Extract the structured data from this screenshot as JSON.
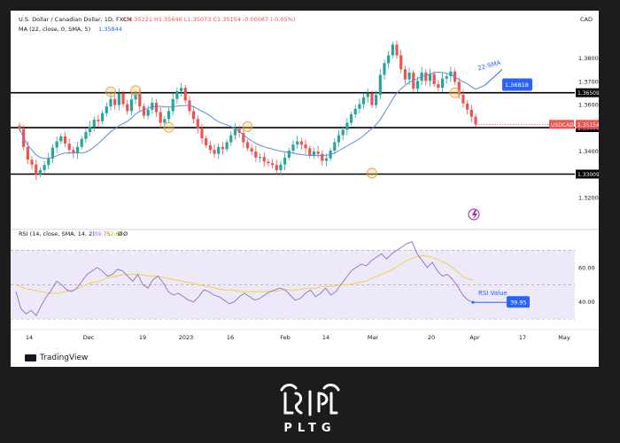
{
  "header": {
    "title": "U.S. Dollar / Canadian Dollar, 1D, FXCM",
    "ohlc": "O1.35221 H1.35646 L1.35073 C1.35154 -0.00067 (-0.05%)",
    "ma_info": "MA (22, close, 0, SMA, 5)",
    "ma_value": "1.35844",
    "currency": "CAD"
  },
  "footer": {
    "tradingview": "TradingView",
    "brand": "PLTG"
  },
  "colors": {
    "up": "#26a69a",
    "down": "#ef5350",
    "ma": "#5b8bd9",
    "rsi": "#8e6fd0",
    "rsi_sma": "#f5d13a",
    "accent_blue": "#2962ff",
    "rsi_band": "#ede9f9"
  },
  "chart_data": [
    {
      "type": "candlestick",
      "title": "U.S. Dollar / Canadian Dollar, 1D, FXCM",
      "ylim": [
        1.312,
        1.3905
      ],
      "yticks": [
        "1.38000",
        "1.37000",
        "1.36000",
        "1.35000",
        "1.34000",
        "1.33000",
        "1.32000"
      ],
      "xticks": [
        "14",
        "Dec",
        "19",
        "2023",
        "16",
        "Feb",
        "14",
        "Mar",
        "20",
        "Apr",
        "17",
        "May"
      ],
      "series": [
        {
          "name": "USDCAD",
          "close_path": [
            1.3495,
            1.3418,
            1.3363,
            1.3342,
            1.33,
            1.3318,
            1.334,
            1.3368,
            1.3415,
            1.3442,
            1.3463,
            1.3432,
            1.3405,
            1.339,
            1.3418,
            1.3452,
            1.3482,
            1.3505,
            1.3535,
            1.3528,
            1.3563,
            1.3592,
            1.3624,
            1.3598,
            1.3648,
            1.3602,
            1.3572,
            1.3622,
            1.3646,
            1.3592,
            1.3552,
            1.3578,
            1.3608,
            1.3568,
            1.3522,
            1.3538,
            1.3572,
            1.3624,
            1.3658,
            1.3672,
            1.3618,
            1.3572,
            1.3538,
            1.3496,
            1.3455,
            1.3425,
            1.3405,
            1.3388,
            1.3418,
            1.3408,
            1.3438,
            1.3468,
            1.3495,
            1.3478,
            1.3438,
            1.3412,
            1.3398,
            1.3372,
            1.3375,
            1.3355,
            1.3348,
            1.334,
            1.3318,
            1.3342,
            1.3372,
            1.3402,
            1.3428,
            1.3442,
            1.3428,
            1.3412,
            1.3382,
            1.3398,
            1.3388,
            1.3358,
            1.3368,
            1.3402,
            1.3438,
            1.3468,
            1.3492,
            1.3522,
            1.3558,
            1.3582,
            1.3602,
            1.3632,
            1.3648,
            1.3598,
            1.3642,
            1.3728,
            1.3778,
            1.3812,
            1.3858,
            1.3812,
            1.3752,
            1.3708,
            1.3738,
            1.3668,
            1.3702,
            1.3738,
            1.3702,
            1.3732,
            1.3688,
            1.3672,
            1.3712,
            1.3722,
            1.3742,
            1.3698,
            1.3642,
            1.3605,
            1.3578,
            1.3548,
            1.3515
          ]
        },
        {
          "name": "MA (22, close, 0, SMA, 5)",
          "label": "22-SMA",
          "last": 1.3682
        }
      ],
      "horizontal_levels": [
        {
          "value": 1.3651,
          "label": "1.36509"
        },
        {
          "value": 1.3501,
          "label": "1.35006"
        },
        {
          "value": 1.3301,
          "label": "1.33009"
        }
      ],
      "price_labels": [
        {
          "value": 1.3682,
          "label": "1.36818"
        },
        {
          "value": 1.3515,
          "tag": "USDCAD",
          "label": "1.35154"
        }
      ],
      "annotations": [
        "22-SMA"
      ]
    },
    {
      "type": "line",
      "title": "RSI (14, close, SMA, 14, 2)",
      "header_values": [
        "39.75",
        "52.66",
        "Ø",
        "Ø"
      ],
      "ylim": [
        28,
        77
      ],
      "yticks": [
        "60.00",
        "40.00"
      ],
      "band": [
        30,
        70
      ],
      "midline": 50,
      "series": [
        {
          "name": "RSI",
          "values": [
            46,
            36,
            33,
            35,
            32,
            38,
            43,
            47,
            52,
            50,
            47,
            46,
            48,
            52,
            56,
            58,
            60,
            58,
            55,
            56,
            59,
            58,
            55,
            52,
            56,
            50,
            48,
            53,
            55,
            51,
            46,
            44,
            45,
            43,
            41,
            40,
            43,
            47,
            46,
            44,
            43,
            41,
            39,
            40,
            43,
            45,
            43,
            41,
            42,
            44,
            46,
            47,
            48,
            47,
            44,
            41,
            42,
            45,
            47,
            43,
            45,
            48,
            44,
            46,
            50,
            54,
            58,
            60,
            62,
            61,
            64,
            66,
            68,
            65,
            68,
            70,
            72,
            74,
            75,
            68,
            64,
            60,
            63,
            58,
            55,
            56,
            53,
            49,
            44,
            41,
            39.75
          ]
        },
        {
          "name": "RSI-based MA",
          "values": [
            50,
            48,
            47,
            46,
            45,
            45,
            46,
            47,
            49,
            51,
            52,
            54,
            55,
            56,
            56,
            56,
            55,
            55,
            54,
            53,
            52,
            51,
            50,
            49,
            48,
            47,
            47,
            46,
            46,
            46,
            46,
            46,
            47,
            47,
            47,
            48,
            48,
            49,
            49,
            50,
            50,
            51,
            52,
            54,
            56,
            58,
            61,
            64,
            66,
            67,
            66,
            64,
            62,
            58,
            54,
            52.66
          ]
        }
      ],
      "annotations": [
        "RSI Value"
      ],
      "last_label": "39.95"
    }
  ]
}
